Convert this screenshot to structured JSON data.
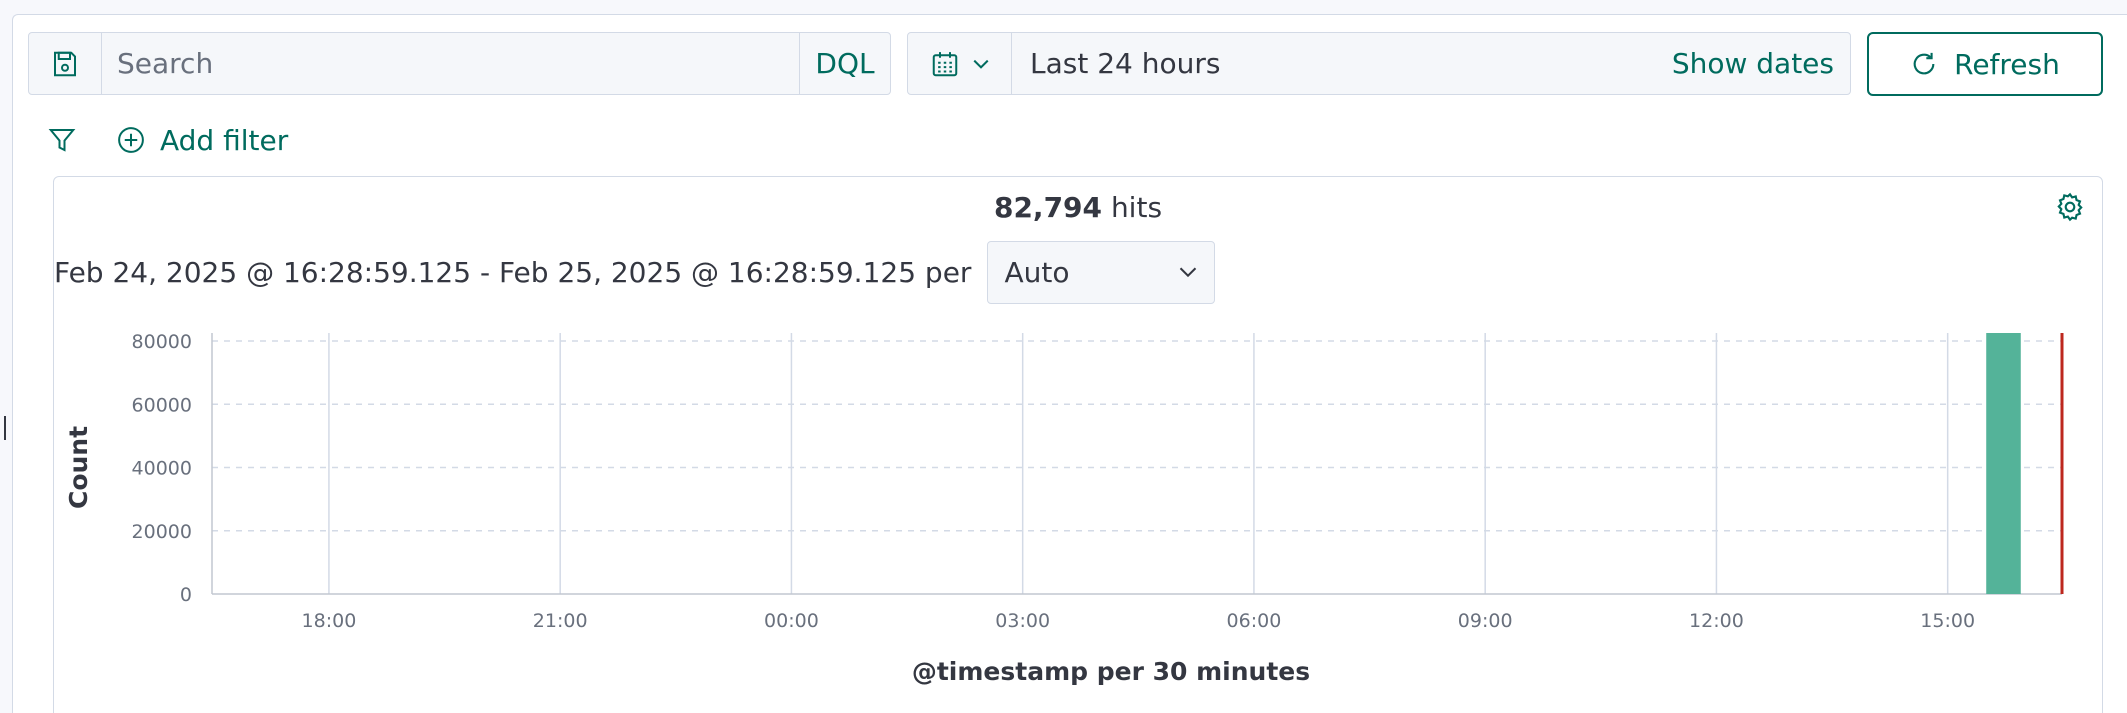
{
  "query": {
    "search_placeholder": "Search",
    "language_label": "DQL",
    "save_icon": "save-icon"
  },
  "time": {
    "quick_menu_icon": "calendar-icon",
    "range_label": "Last 24 hours",
    "show_dates_label": "Show dates",
    "refresh_label": "Refresh"
  },
  "filters": {
    "filter_icon": "funnel-icon",
    "add_filter_label": "Add filter"
  },
  "histogram": {
    "hits_count": "82,794",
    "hits_label": "hits",
    "range_text": "Feb 24, 2025 @ 16:28:59.125 - Feb 25, 2025 @ 16:28:59.125 per",
    "interval_value": "Auto"
  },
  "colors": {
    "accent": "#006b5e",
    "bar": "#54b399",
    "current_time_marker": "#bd271e"
  },
  "chart_data": {
    "type": "bar",
    "xlabel": "@timestamp per 30 minutes",
    "ylabel": "Count",
    "ylim": [
      0,
      82794
    ],
    "y_ticks": [
      0,
      20000,
      40000,
      60000,
      80000
    ],
    "y_tick_labels": [
      "0",
      "20000",
      "40000",
      "60000",
      "80000"
    ],
    "x_domain_hours": [
      16.483,
      40.483
    ],
    "x_ticks": [
      "18:00",
      "21:00",
      "00:00",
      "03:00",
      "06:00",
      "09:00",
      "12:00",
      "15:00"
    ],
    "x_tick_hours": [
      18,
      21,
      24,
      27,
      30,
      33,
      36,
      39
    ],
    "grid": true,
    "series": [
      {
        "x": [
          "15:30"
        ],
        "x_hours": [
          39.5
        ],
        "values": [
          82794
        ],
        "interval_hours": 0.5
      }
    ],
    "current_time_marker": "16:28:59.125",
    "current_time_hours": 40.483
  }
}
